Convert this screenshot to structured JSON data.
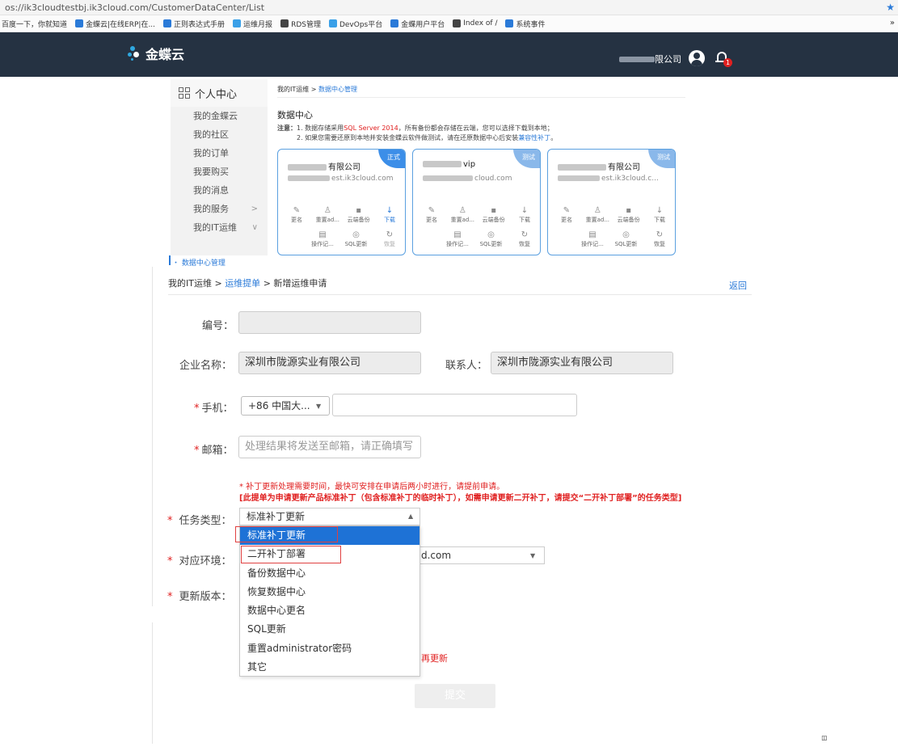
{
  "browser": {
    "url": "os://ik3cloudtestbj.ik3cloud.com/CustomerDataCenter/List",
    "bookmarks": [
      {
        "label": "百度一下，你就知道",
        "color": ""
      },
      {
        "label": "金蝶云|在线ERP|在...",
        "color": "#2a7ad8"
      },
      {
        "label": "正则表达式手册",
        "color": "#2a7ad8"
      },
      {
        "label": "运维月报",
        "color": "#3aa0e8"
      },
      {
        "label": "RDS管理",
        "color": "#444444"
      },
      {
        "label": "DevOps平台",
        "color": "#3aa0e8"
      },
      {
        "label": "金蝶用户平台",
        "color": "#2a7ad8"
      },
      {
        "label": "Index of /",
        "color": "#444444"
      },
      {
        "label": "系统事件",
        "color": "#2a7ad8"
      }
    ]
  },
  "header": {
    "logo_text": "金蝶云",
    "user_suffix": "限公司",
    "notification_count": "1",
    "bg_color": "#253242"
  },
  "sidebar": {
    "title": "个人中心",
    "items": [
      {
        "label": "我的金蝶云",
        "arrow": ""
      },
      {
        "label": "我的社区",
        "arrow": ""
      },
      {
        "label": "我的订单",
        "arrow": ""
      },
      {
        "label": "我要购买",
        "arrow": ""
      },
      {
        "label": "我的消息",
        "arrow": ""
      },
      {
        "label": "我的服务",
        "arrow": ">"
      },
      {
        "label": "我的IT运维",
        "arrow": "∨"
      }
    ],
    "sub_item": "・ 数据中心管理"
  },
  "datacenter": {
    "crumb_root": "我的IT运维 >",
    "crumb_current": "数据中心管理",
    "title": "数据中心",
    "note_label": "注意：",
    "note1_a": "1. 数据存储采用",
    "note1_red": "SQL Server 2014",
    "note1_b": "，所有备份都会存储在云端，您可以选择下载到本地；",
    "note2_a": "2. 如果您需要还原到本地并安装金蝶云软件做测试，请在还原数据中心后安装",
    "note2_blue": "兼容性补丁",
    "note2_b": "。",
    "cards": [
      {
        "name": "有限公司",
        "url": "est.ik3cloud.com",
        "badge": "正式",
        "type": "formal"
      },
      {
        "name": "vip",
        "url": "cloud.com",
        "badge": "测试",
        "type": "test"
      },
      {
        "name": "有限公司",
        "url": "est.ik3cloud.c...",
        "badge": "测试",
        "type": "test"
      }
    ],
    "actions_row1": [
      "更名",
      "重置ad...",
      "云端备份",
      "下载"
    ],
    "actions_row2": [
      "操作记...",
      "SQL更新",
      "恢复"
    ]
  },
  "form": {
    "crumb_root": "我的IT运维 >",
    "crumb_link": "运维提单",
    "crumb_current": "> 新增运维申请",
    "back": "返回",
    "labels": {
      "number": "编号：",
      "company": "企业名称：",
      "contact": "联系人：",
      "phone": "手机：",
      "email": "邮箱：",
      "task_type": "任务类型：",
      "env": "对应环境：",
      "version": "更新版本："
    },
    "values": {
      "number": "",
      "company": "深圳市陇源实业有限公司",
      "contact": "深圳市陇源实业有限公司",
      "phone_code": "+86 中国大...",
      "phone": "",
      "task_type": "标准补丁更新",
      "env": "d.com"
    },
    "placeholders": {
      "email": "处理结果将发送至邮箱，请正确填写"
    },
    "hint1": "* 补丁更新处理需要时间，最快可安排在申请后两小时进行，请提前申请。",
    "hint2": "[此提单为申请更新产品标准补丁（包含标准补丁的临时补丁），如需申请更新二开补丁，请提交“二开补丁部署”的任务类型]",
    "task_options": [
      "标准补丁更新",
      "二开补丁部署",
      "备份数据中心",
      "恢复数据中心",
      "数据中心更名",
      "SQL更新",
      "重置administrator密码",
      "其它"
    ],
    "tail_hint": "再更新",
    "submit": "提交"
  },
  "colors": {
    "accent": "#2a7ad8",
    "selected": "#1e72d6",
    "error": "#e02020"
  }
}
